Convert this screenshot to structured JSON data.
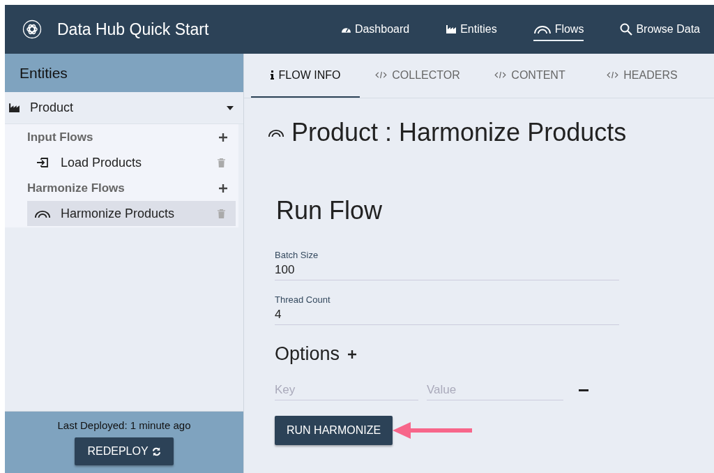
{
  "app": {
    "title": "Data Hub Quick Start"
  },
  "nav": [
    {
      "label": "Dashboard",
      "kind": "dashboard",
      "selected": false
    },
    {
      "label": "Entities",
      "kind": "entities",
      "selected": false
    },
    {
      "label": "Flows",
      "kind": "flows",
      "selected": true
    },
    {
      "label": "Browse Data",
      "kind": "search",
      "selected": false
    }
  ],
  "sidebar": {
    "title": "Entities",
    "entities": [
      {
        "name": "Product",
        "expanded": true,
        "groups": [
          {
            "label": "Input Flows",
            "items": [
              {
                "name": "Load Products",
                "kind": "input",
                "selected": false
              }
            ]
          },
          {
            "label": "Harmonize Flows",
            "items": [
              {
                "name": "Harmonize Products",
                "kind": "harmonize",
                "selected": true
              }
            ]
          }
        ]
      }
    ],
    "last_deployed": "Last Deployed: 1 minute ago",
    "redeploy_button": "REDEPLOY"
  },
  "tabs": [
    {
      "label": "FLOW INFO",
      "kind": "info",
      "selected": true
    },
    {
      "label": "COLLECTOR",
      "kind": "code",
      "selected": false
    },
    {
      "label": "CONTENT",
      "kind": "code",
      "selected": false
    },
    {
      "label": "HEADERS",
      "kind": "code",
      "selected": false
    }
  ],
  "flow_title": "Product : Harmonize Products",
  "run_flow": {
    "heading": "Run Flow",
    "fields": [
      {
        "label": "Batch Size",
        "value": "100"
      },
      {
        "label": "Thread Count",
        "value": "4"
      }
    ],
    "options_heading": "Options",
    "options": [
      {
        "key_placeholder": "Key",
        "value_placeholder": "Value"
      }
    ],
    "run_button": "RUN HARMONIZE"
  }
}
